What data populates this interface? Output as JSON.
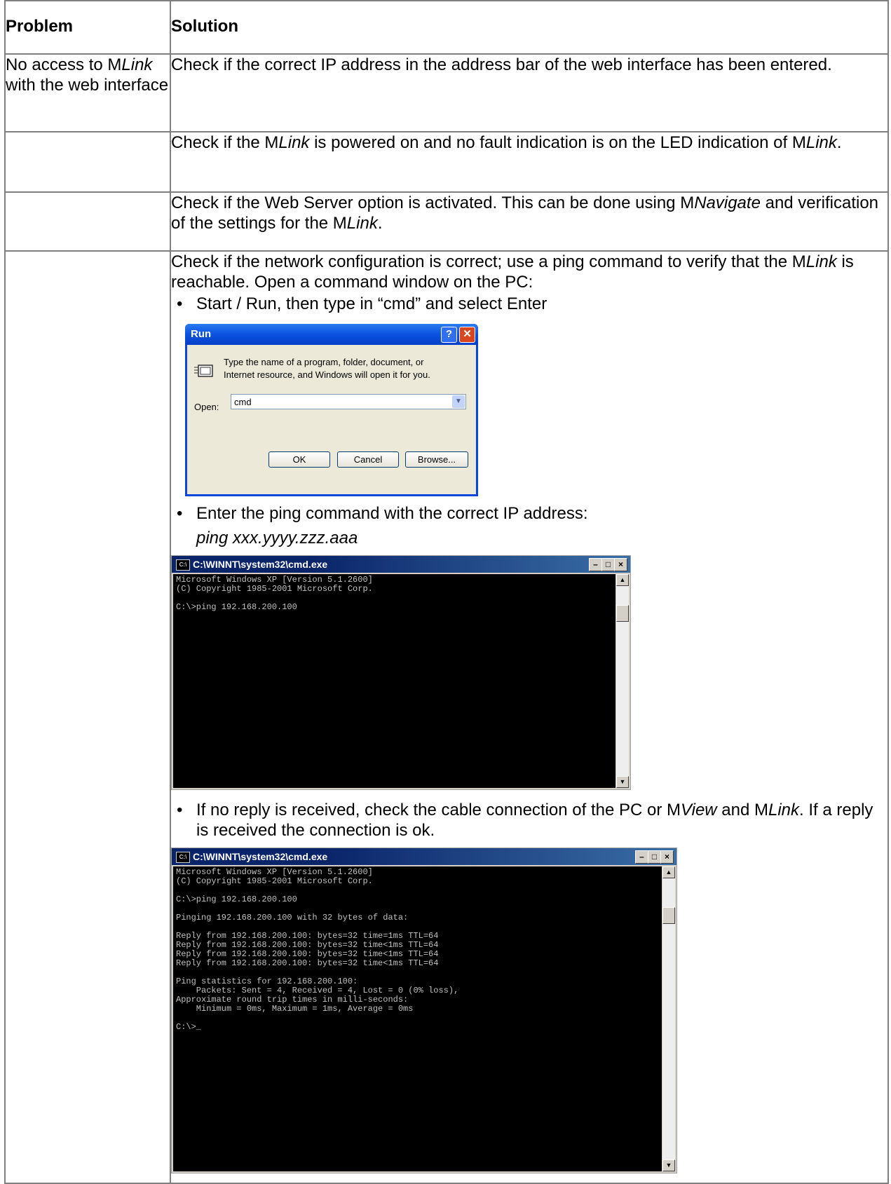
{
  "table": {
    "headers": {
      "problem": "Problem",
      "solution": "Solution"
    },
    "rows": [
      {
        "problem": "No access to MLink with the web interface",
        "solution": "Check if the correct IP address in the address bar of the web interface has been entered."
      },
      {
        "problem": "",
        "solution": "Check if the MLink is powered on and no fault indication is on the LED indication of MLink."
      },
      {
        "problem": "",
        "solution": "Check if the Web Server option is activated. This can be done using MNavigate and verification of the settings for the MLink."
      },
      {
        "problem": "",
        "solution": "Check if the network configuration is correct; use a ping command to verify that the MLink is reachable. Open a command window on the PC:"
      }
    ]
  },
  "steps": {
    "step1": "Start / Run, then type in “cmd” and select Enter",
    "step2": "Enter the ping command with the correct IP address:",
    "step2_cmd": "ping xxx.yyyy.zzz.aaa",
    "step3": "If no reply is received, check the cable connection of the PC or MView and MLink. If a reply is received the connection is ok."
  },
  "run_dialog": {
    "title": "Run",
    "message_line1": "Type the name of a program, folder, document, or",
    "message_line2": "Internet resource, and Windows will open it for you.",
    "open_label": "Open:",
    "open_value": "cmd",
    "ok_label": "OK",
    "cancel_label": "Cancel",
    "browse_label": "Browse..."
  },
  "cmd1": {
    "title": "C:\\WINNT\\system32\\cmd.exe",
    "lines": "Microsoft Windows XP [Version 5.1.2600]\n(C) Copyright 1985-2001 Microsoft Corp.\n\nC:\\>ping 192.168.200.100"
  },
  "cmd2": {
    "title": "C:\\WINNT\\system32\\cmd.exe",
    "lines": "Microsoft Windows XP [Version 5.1.2600]\n(C) Copyright 1985-2001 Microsoft Corp.\n\nC:\\>ping 192.168.200.100\n\nPinging 192.168.200.100 with 32 bytes of data:\n\nReply from 192.168.200.100: bytes=32 time=1ms TTL=64\nReply from 192.168.200.100: bytes=32 time<1ms TTL=64\nReply from 192.168.200.100: bytes=32 time<1ms TTL=64\nReply from 192.168.200.100: bytes=32 time<1ms TTL=64\n\nPing statistics for 192.168.200.100:\n    Packets: Sent = 4, Received = 4, Lost = 0 (0% loss),\nApproximate round trip times in milli-seconds:\n    Minimum = 0ms, Maximum = 1ms, Average = 0ms\n\nC:\\>_"
  }
}
